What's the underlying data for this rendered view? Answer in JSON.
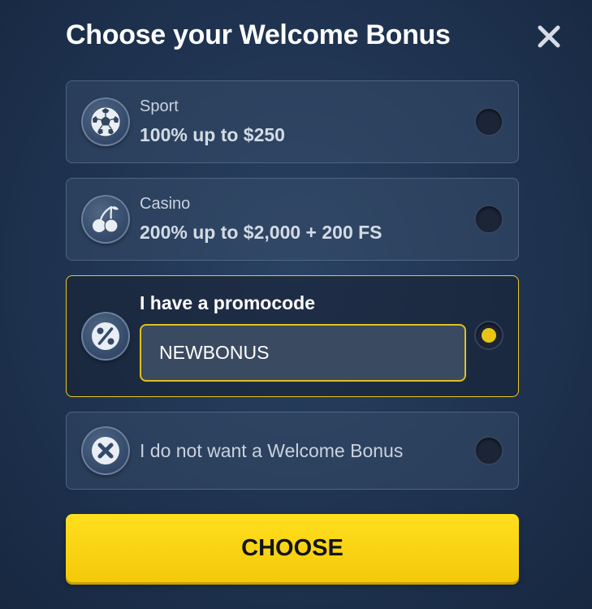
{
  "dialog": {
    "title": "Choose your Welcome Bonus",
    "close_icon": "close-icon"
  },
  "options": [
    {
      "id": "sport",
      "category": "Sport",
      "offer": "100% up to $250",
      "icon": "soccer-ball-icon",
      "selected": false
    },
    {
      "id": "casino",
      "category": "Casino",
      "offer": "200% up to $2,000 + 200 FS",
      "icon": "cherry-icon",
      "selected": false
    },
    {
      "id": "promocode",
      "label": "I have a promocode",
      "input_value": "NEWBONUS",
      "icon": "percent-icon",
      "selected": true
    },
    {
      "id": "none",
      "label": "I do not want a Welcome Bonus",
      "icon": "x-circle-icon",
      "selected": false
    }
  ],
  "choose_button": {
    "label": "CHOOSE"
  },
  "colors": {
    "accent": "#f4c90a",
    "selected_border": "#e9c91c",
    "background": "#1f3350"
  }
}
